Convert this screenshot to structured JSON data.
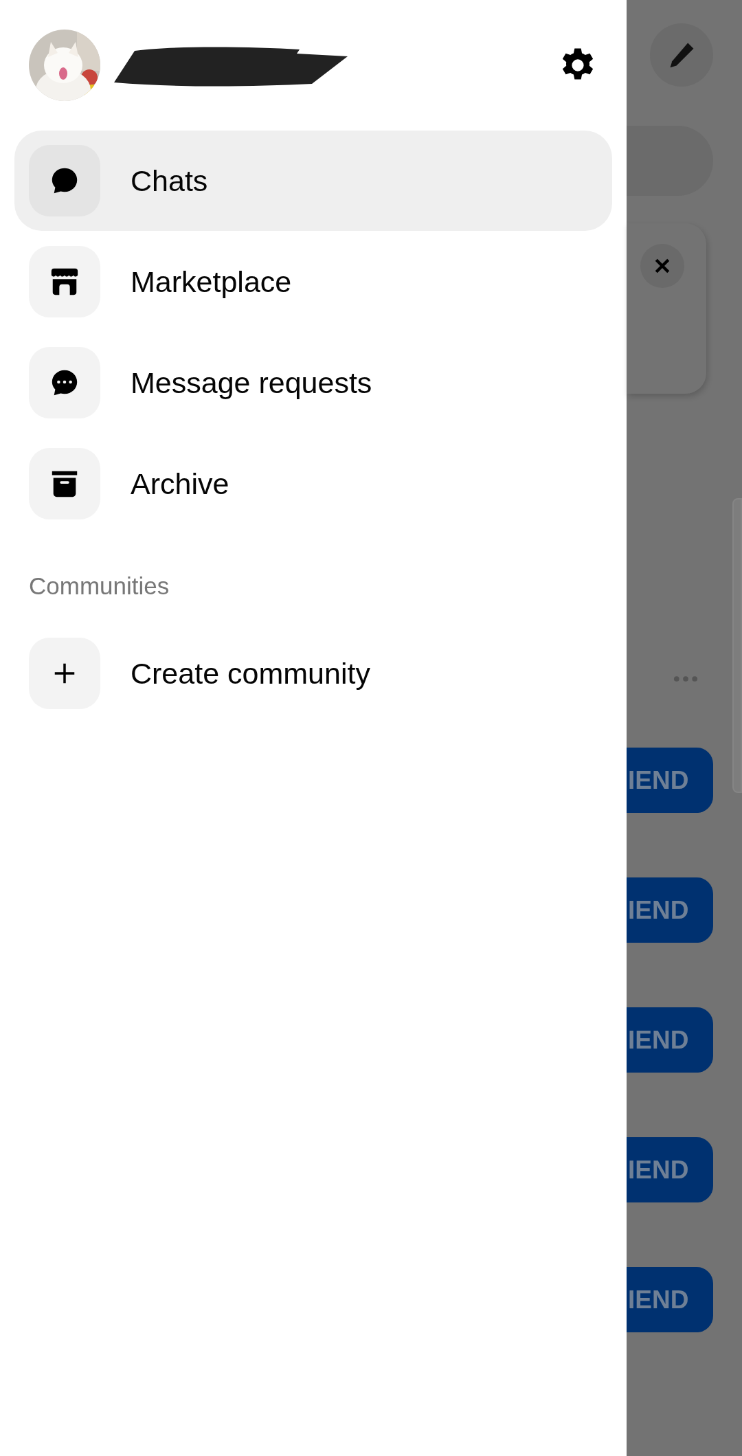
{
  "drawer": {
    "items": [
      {
        "label": "Chats",
        "kind": "chat",
        "selected": true
      },
      {
        "label": "Marketplace",
        "kind": "store",
        "selected": false
      },
      {
        "label": "Message requests",
        "kind": "requests",
        "selected": false
      },
      {
        "label": "Archive",
        "kind": "archive",
        "selected": false
      }
    ],
    "section_title": "Communities",
    "community_items": [
      {
        "label": "Create community",
        "kind": "plus",
        "selected": false
      }
    ]
  },
  "background": {
    "buttons": [
      "IEND",
      "IEND",
      "IEND",
      "IEND",
      "IEND"
    ]
  }
}
